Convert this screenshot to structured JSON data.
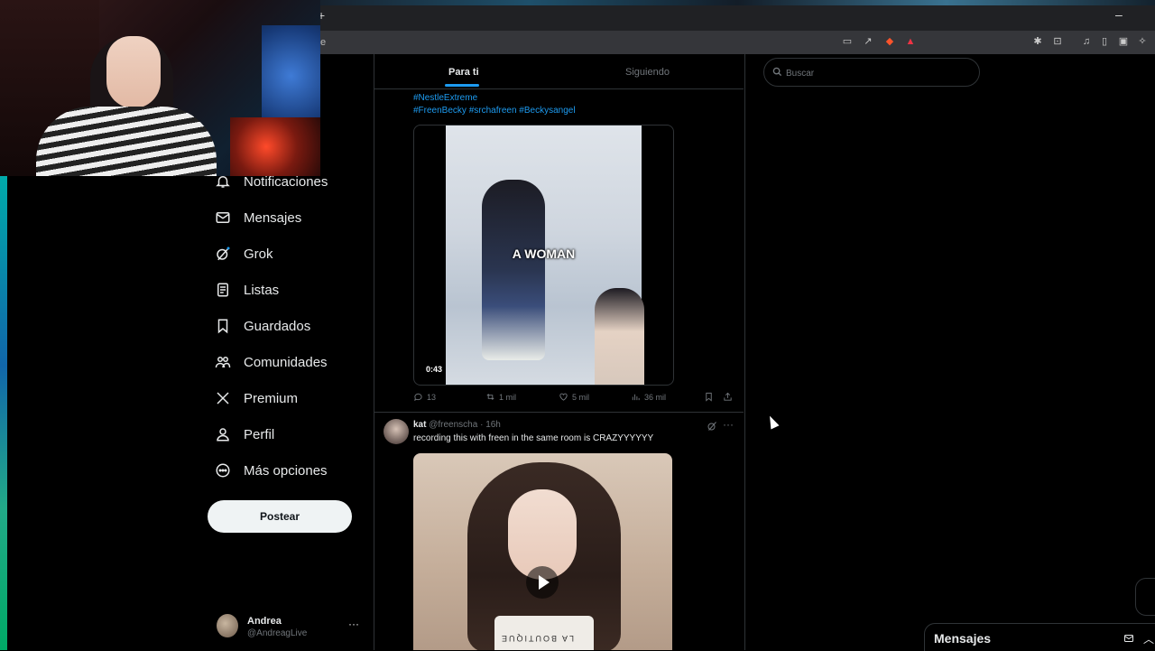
{
  "browser": {
    "address_text": "e",
    "new_tab_symbol": "+",
    "minimize_symbol": "–"
  },
  "sidebar": {
    "items": [
      {
        "label": "Notificaciones",
        "icon": "bell-icon"
      },
      {
        "label": "Mensajes",
        "icon": "envelope-icon"
      },
      {
        "label": "Grok",
        "icon": "grok-icon"
      },
      {
        "label": "Listas",
        "icon": "list-icon"
      },
      {
        "label": "Guardados",
        "icon": "bookmark-icon"
      },
      {
        "label": "Comunidades",
        "icon": "people-icon"
      },
      {
        "label": "Premium",
        "icon": "x-logo-icon"
      },
      {
        "label": "Perfil",
        "icon": "person-icon"
      },
      {
        "label": "Más opciones",
        "icon": "more-circle-icon"
      }
    ],
    "post_button": "Postear",
    "profile": {
      "name": "Andrea",
      "handle": "@AndreagLive",
      "more": "···"
    }
  },
  "timeline": {
    "tabs": [
      {
        "label": "Para ti",
        "active": true
      },
      {
        "label": "Siguiendo",
        "active": false
      }
    ],
    "tweet1": {
      "hashtags_line1": "#NestleExtreme",
      "hashtags_line2": "#FreenBecky #srchafreen #Beckysangel",
      "video_overlay": "A WOMAN",
      "video_duration": "0:43",
      "stats": {
        "replies": "13",
        "reposts": "1 mil",
        "likes": "5 mil",
        "views": "36 mil"
      }
    },
    "tweet2": {
      "name": "kat",
      "handle_time": "@freenscha · 16h",
      "text": "recording this with freen in the same room is CRAZYYYYYY",
      "shirt_text": "LA BOUTIQUE"
    }
  },
  "search": {
    "placeholder": "Buscar"
  },
  "messages_drawer": {
    "title": "Mensajes",
    "collapse_symbol": "︿"
  },
  "colors": {
    "accent": "#1d9bf0",
    "background": "#000000",
    "text": "#e7e9ea",
    "muted": "#71767b",
    "border": "#2f3336"
  }
}
